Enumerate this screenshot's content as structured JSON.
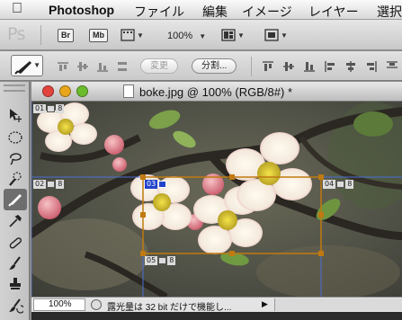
{
  "menubar": {
    "app_name": "Photoshop",
    "items": [
      "ファイル",
      "編集",
      "イメージ",
      "レイヤー",
      "選択"
    ]
  },
  "appbar": {
    "logo": "Ps",
    "bridge_label": "Br",
    "minibridge_label": "Mb",
    "zoom_label": "100%"
  },
  "options": {
    "btn_edit_label": "変更",
    "btn_divide_label": "分割..."
  },
  "document": {
    "title": "boke.jpg @ 100% (RGB/8#) *",
    "slices": [
      {
        "num": "01",
        "size": "8",
        "selected": false
      },
      {
        "num": "02",
        "size": "8",
        "selected": false
      },
      {
        "num": "03",
        "size": "",
        "selected": true
      },
      {
        "num": "04",
        "size": "8",
        "selected": false
      },
      {
        "num": "05",
        "size": "8",
        "selected": false
      }
    ]
  },
  "statusbar": {
    "zoom": "100%",
    "message": "露光量は 32 bit だけで機能し..."
  },
  "colors": {
    "slice_line": "#4a6fd6",
    "selected_slice": "#c07a10",
    "selected_label": "#2244cc"
  }
}
